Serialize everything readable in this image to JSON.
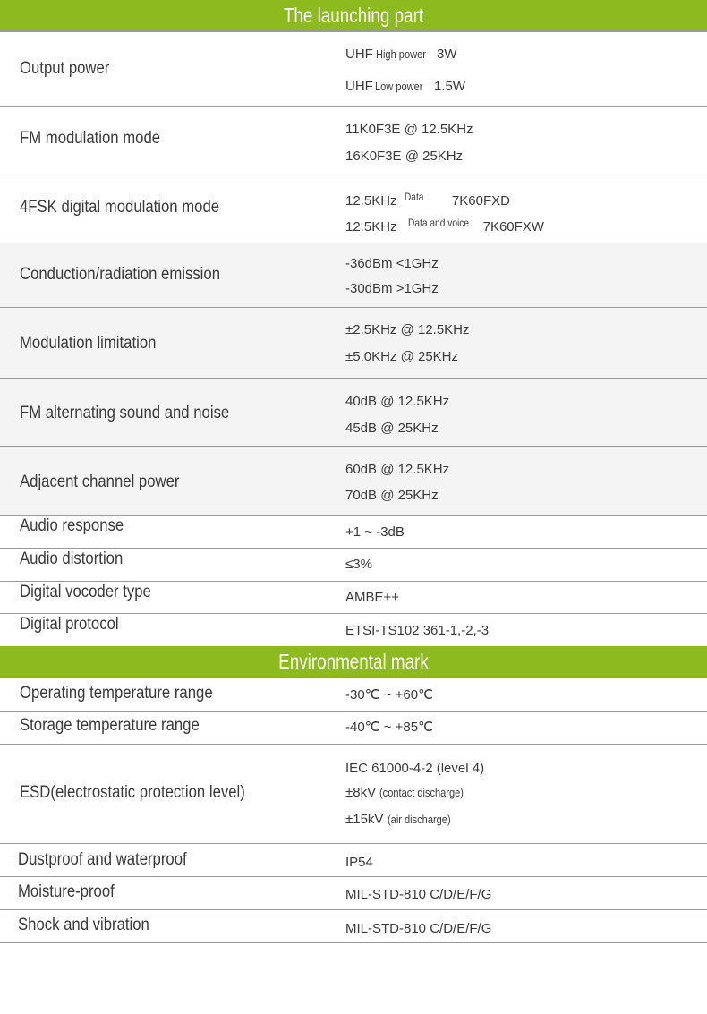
{
  "sections": {
    "launching": {
      "title": "The launching part"
    },
    "environmental": {
      "title": "Environmental mark"
    }
  },
  "launching_rows": {
    "output_power": {
      "label": "Output power",
      "line1_a": "UHF",
      "line1_b": "High power",
      "line1_c": "3W",
      "line2_a": "UHF",
      "line2_b": "Low power",
      "line2_c": "1.5W"
    },
    "fm_mod": {
      "label": "FM modulation mode",
      "line1": "11K0F3E @ 12.5KHz",
      "line2": "16K0F3E @ 25KHz"
    },
    "fsk_mod": {
      "label": "4FSK digital modulation mode",
      "line1_a": "12.5KHz",
      "line1_b": "Data",
      "line1_c": "7K60FXD",
      "line2_a": "12.5KHz",
      "line2_b": "Data and voice",
      "line2_c": "7K60FXW"
    },
    "emission": {
      "label": "Conduction/radiation emission",
      "line1": "-36dBm <1GHz",
      "line2": "-30dBm >1GHz"
    },
    "mod_limit": {
      "label": "Modulation limitation",
      "line1": "±2.5KHz @ 12.5KHz",
      "line2": "±5.0KHz @ 25KHz"
    },
    "fm_noise": {
      "label": "FM alternating sound and noise",
      "line1": "40dB @ 12.5KHz",
      "line2": "45dB @ 25KHz"
    },
    "adjacent": {
      "label": "Adjacent channel power",
      "line1": "60dB @ 12.5KHz",
      "line2": "70dB @ 25KHz"
    },
    "audio_resp": {
      "label": "Audio response",
      "value": "+1 ~ -3dB"
    },
    "audio_dist": {
      "label": "Audio distortion",
      "value": "≤3%"
    },
    "vocoder": {
      "label": "Digital vocoder type",
      "value": "AMBE++"
    },
    "protocol": {
      "label": "Digital protocol",
      "value": "ETSI-TS102 361-1,-2,-3"
    }
  },
  "env_rows": {
    "op_temp": {
      "label": "Operating temperature range",
      "value": "-30℃ ~ +60℃"
    },
    "st_temp": {
      "label": "Storage temperature range",
      "value": "-40℃ ~ +85℃"
    },
    "esd": {
      "label": "ESD(electrostatic protection level)",
      "line1": "IEC 61000-4-2 (level 4)",
      "line2_a": "±8kV",
      "line2_b": "(contact discharge)",
      "line3_a": "±15kV",
      "line3_b": "(air discharge)"
    },
    "dust": {
      "label": "Dustproof and waterproof",
      "value": "IP54"
    },
    "moisture": {
      "label": "Moisture-proof",
      "value": "MIL-STD-810 C/D/E/F/G"
    },
    "shock": {
      "label": "Shock and vibration",
      "value": "MIL-STD-810 C/D/E/F/G"
    }
  }
}
